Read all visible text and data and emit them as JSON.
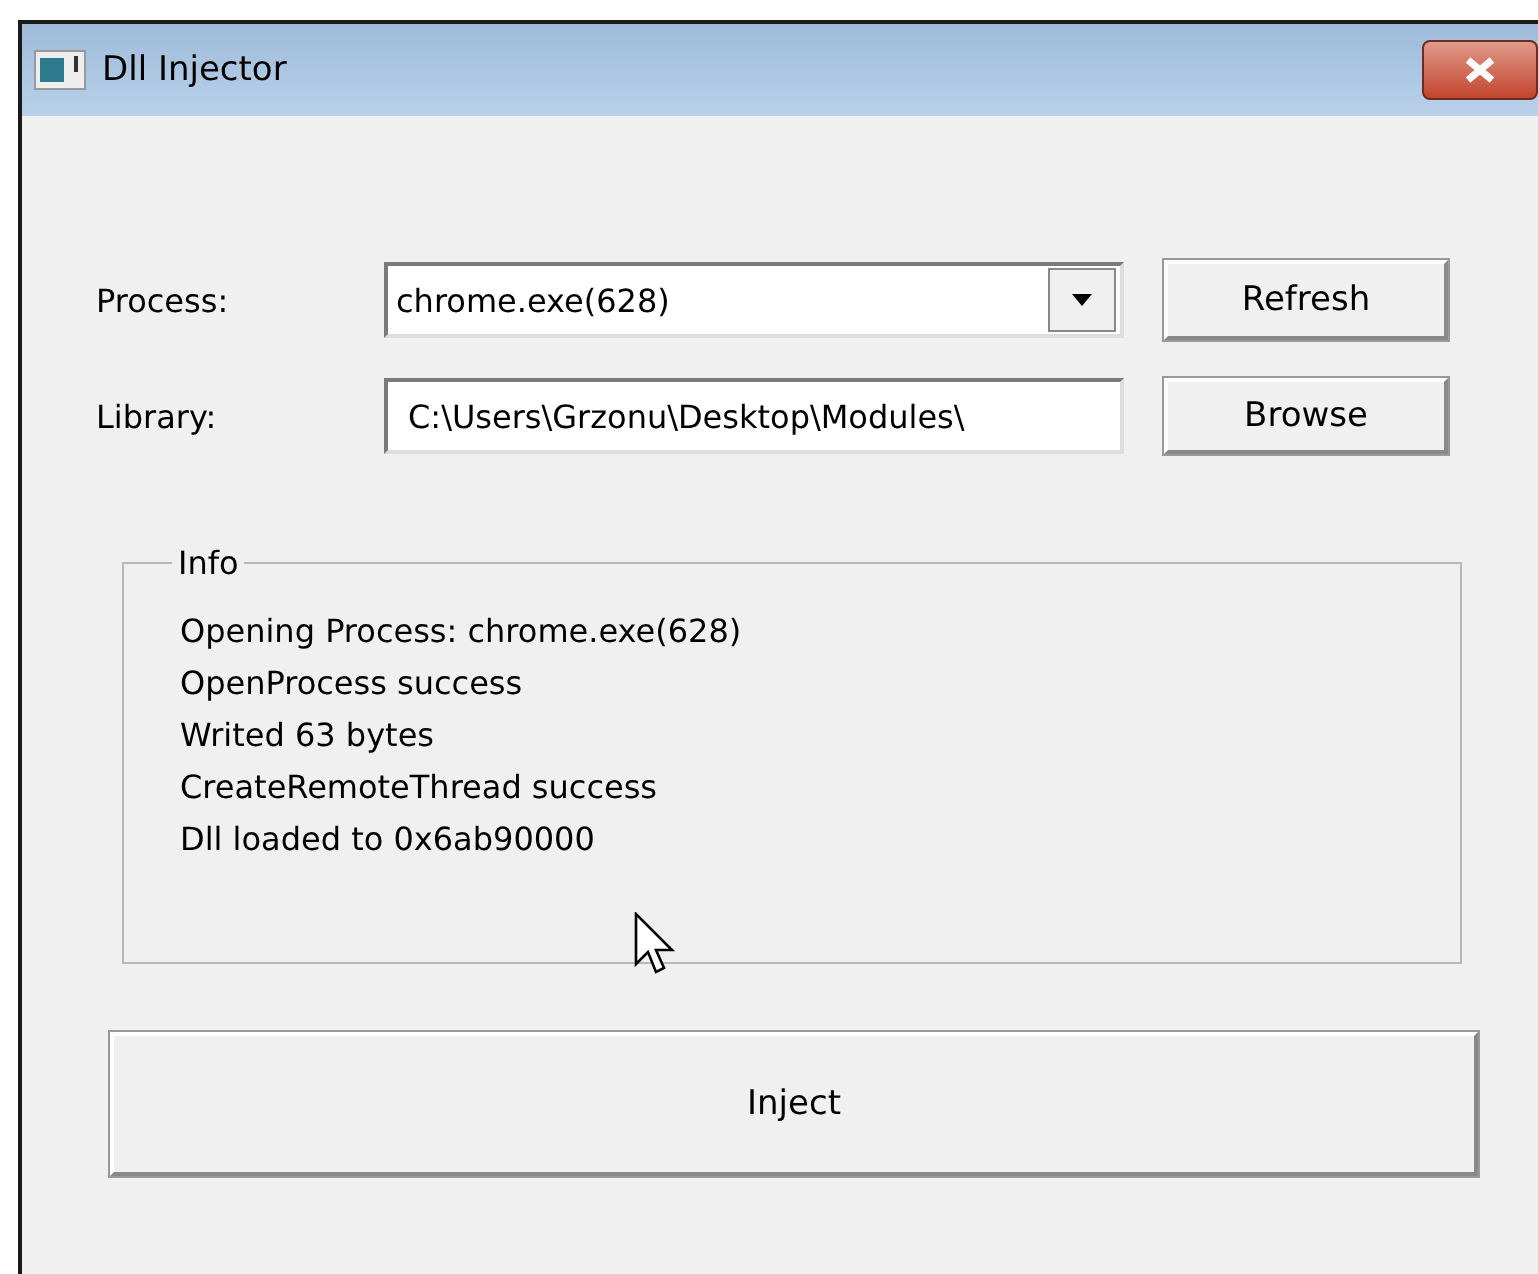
{
  "window": {
    "title": "Dll Injector"
  },
  "form": [
    {
      "label": "Process:",
      "kind": "dropdown",
      "value": "chrome.exe(628)",
      "button": "Refresh"
    },
    {
      "label": "Library:",
      "kind": "text",
      "value": "C:\\Users\\Grzonu\\Desktop\\Modules\\",
      "button": "Browse"
    }
  ],
  "info": {
    "title": "Info",
    "lines": [
      "Opening Process: chrome.exe(628)",
      "OpenProcess success",
      "Writed 63 bytes",
      "CreateRemoteThread success",
      "Dll loaded to 0x6ab90000"
    ]
  },
  "action_button": "Inject"
}
